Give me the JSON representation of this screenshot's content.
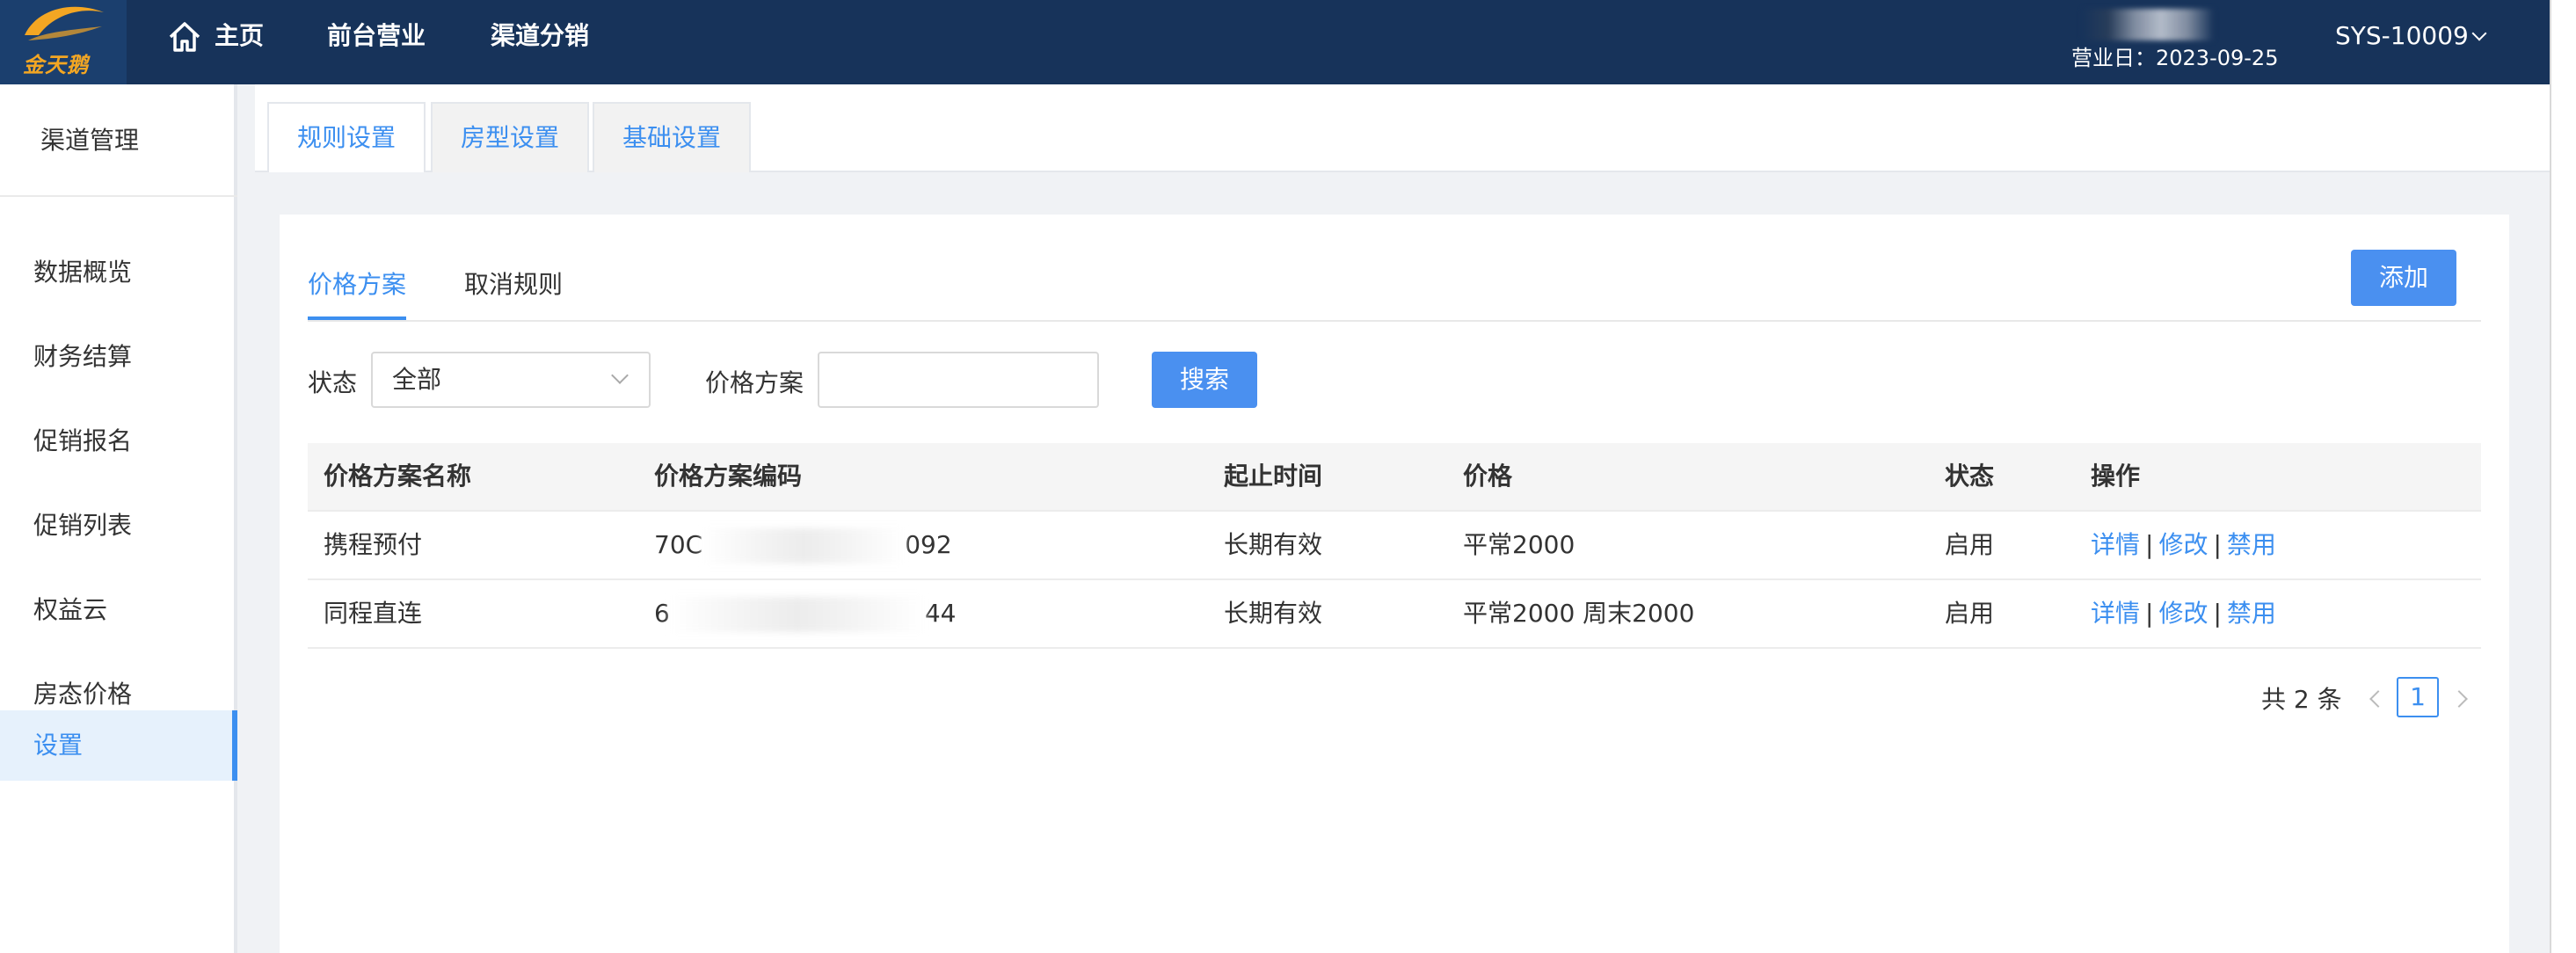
{
  "app": {
    "logo_text": "金天鹅",
    "nav": {
      "home": "主页",
      "front_desk": "前台营业",
      "channel": "渠道分销"
    },
    "business_date": "营业日：2023-09-25",
    "system_id": "SYS-10009"
  },
  "sidebar": {
    "title": "渠道管理",
    "items": [
      {
        "label": "数据概览"
      },
      {
        "label": "财务结算"
      },
      {
        "label": "促销报名"
      },
      {
        "label": "促销列表"
      },
      {
        "label": "权益云"
      },
      {
        "label": "房态价格"
      },
      {
        "label": "设置",
        "active": true
      }
    ]
  },
  "content_tabs": [
    {
      "label": "规则设置",
      "active": true
    },
    {
      "label": "房型设置"
    },
    {
      "label": "基础设置"
    }
  ],
  "sub_tabs": [
    {
      "label": "价格方案",
      "active": true
    },
    {
      "label": "取消规则"
    }
  ],
  "add_button": "添加",
  "filters": {
    "status_label": "状态",
    "status_value": "全部",
    "plan_label": "价格方案",
    "plan_value": "",
    "search_button": "搜索"
  },
  "table": {
    "headers": [
      "价格方案名称",
      "价格方案编码",
      "起止时间",
      "价格",
      "状态",
      "操作"
    ],
    "rows": [
      {
        "name": "携程预付",
        "code_start": "70C",
        "code_end": "092",
        "period": "长期有效",
        "price": "平常2000",
        "status": "启用"
      },
      {
        "name": "同程直连",
        "code_start": "6",
        "code_end": "44",
        "period": "长期有效",
        "price": "平常2000 周末2000",
        "status": "启用"
      }
    ],
    "actions": {
      "detail": "详情",
      "edit": "修改",
      "disable": "禁用",
      "separator": "|"
    }
  },
  "pagination": {
    "total": "共 2 条",
    "current": "1"
  },
  "colors": {
    "nav_bg": "#17335a",
    "accent": "#3c8ff0",
    "button": "#4a90f0"
  }
}
